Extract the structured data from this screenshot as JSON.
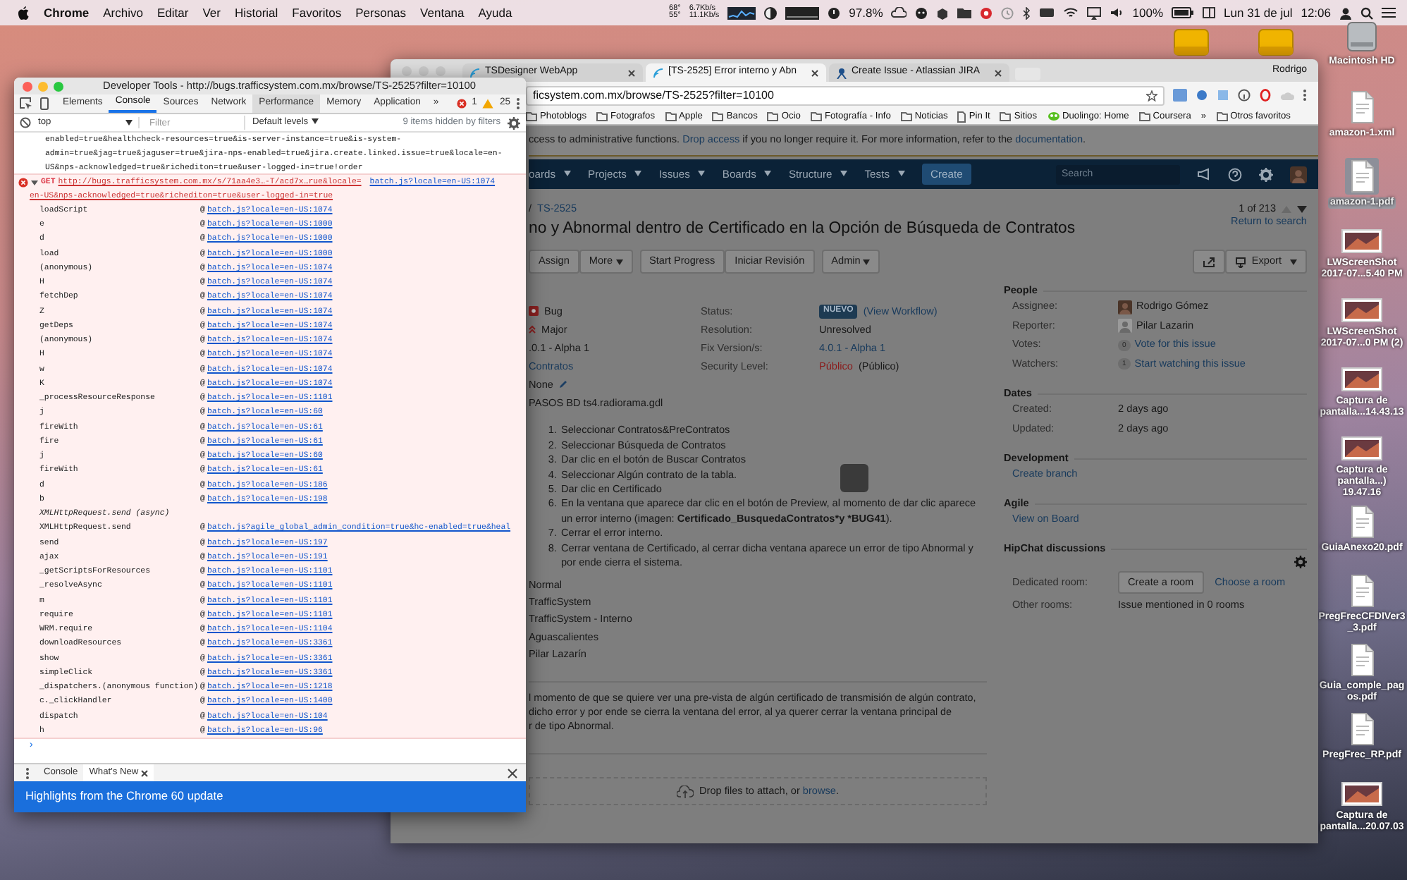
{
  "menu_bar": {
    "app": "Chrome",
    "menus": [
      "Archivo",
      "Editar",
      "Ver",
      "Historial",
      "Favoritos",
      "Personas",
      "Ventana",
      "Ayuda"
    ],
    "temperatures": [
      "68°",
      "55°"
    ],
    "network_speeds": [
      "6.7Kb/s",
      "11.1Kb/s"
    ],
    "cpu_reading": "97.8%",
    "battery_reading": "100%",
    "date": "Lun 31 de jul",
    "time": "12:06"
  },
  "desktop_drives": [
    {
      "kind": "external-drive"
    },
    {
      "kind": "external-drive"
    }
  ],
  "desktop_icons": [
    {
      "label": "Macintosh HD",
      "kind": "drive",
      "selected": false
    },
    {
      "label": "amazon-1.xml",
      "kind": "document",
      "selected": false
    },
    {
      "label": "amazon-1.pdf",
      "kind": "pdf",
      "selected": true
    },
    {
      "label": "LWScreenShot 2017-07...5.40 PM",
      "kind": "screenshot",
      "selected": false
    },
    {
      "label": "LWScreenShot 2017-07...0 PM (2)",
      "kind": "screenshot",
      "selected": false
    },
    {
      "label": "Captura de pantalla...14.43.13",
      "kind": "screenshot",
      "selected": false
    },
    {
      "label": "Captura de pantalla...) 19.47.16",
      "kind": "screenshot",
      "selected": false
    },
    {
      "label": "GuiaAnexo20.pdf",
      "kind": "pdf",
      "selected": false
    },
    {
      "label": "PregFrecCFDIVer3_3.pdf",
      "kind": "pdf",
      "selected": false
    },
    {
      "label": "Guia_comple_pagos.pdf",
      "kind": "pdf",
      "selected": false
    },
    {
      "label": "PregFrec_RP.pdf",
      "kind": "pdf",
      "selected": false
    },
    {
      "label": "Captura de pantalla...20.07.03",
      "kind": "screenshot",
      "selected": false
    }
  ],
  "browser": {
    "tabs": [
      {
        "title": "TSDesigner WebApp",
        "selected": false
      },
      {
        "title": "[TS-2525] Error interno y Abn",
        "selected": true
      },
      {
        "title": "Create Issue - Atlassian JIRA",
        "selected": false
      }
    ],
    "profile": "Rodrigo",
    "url": "ficsystem.com.mx/browse/TS-2525?filter=10100",
    "bookmarks": [
      {
        "label": "Photoblogs",
        "kind": "folder"
      },
      {
        "label": "Fotografos",
        "kind": "folder"
      },
      {
        "label": "Apple",
        "kind": "folder"
      },
      {
        "label": "Bancos",
        "kind": "folder"
      },
      {
        "label": "Ocio",
        "kind": "folder"
      },
      {
        "label": "Fotografía - Info",
        "kind": "folder"
      },
      {
        "label": "Noticias",
        "kind": "folder"
      },
      {
        "label": "Pin It",
        "kind": "page"
      },
      {
        "label": "Sitios",
        "kind": "folder"
      },
      {
        "label": "Duolingo: Home",
        "kind": "site"
      },
      {
        "label": "Coursera",
        "kind": "folder"
      }
    ],
    "bookmarks_overflow": "»",
    "other_bookmarks": "Otros favoritos"
  },
  "jira": {
    "banner": [
      {
        "text": "ccess to administrative functions. ",
        "kind": "text"
      },
      {
        "text": "Drop access",
        "kind": "link"
      },
      {
        "text": " if you no longer require it. For more information, refer to the ",
        "kind": "text"
      },
      {
        "text": "documentation",
        "kind": "link"
      },
      {
        "text": ".",
        "kind": "text"
      }
    ],
    "nav": [
      "oards",
      "Projects",
      "Issues",
      "Boards",
      "Structure",
      "Tests"
    ],
    "create": "Create",
    "search": {
      "placeholder": "Search"
    },
    "breadcrumb": "TS-2525",
    "breadcrumb_separator": "/",
    "title": "no y Abnormal dentro de Certificado en la Opción de Búsqueda de Contratos",
    "pager": "1 of 213",
    "return_link": "Return to search",
    "action_groups": [
      [
        {
          "label": "Assign",
          "dropdown": false
        },
        {
          "label": "More",
          "dropdown": true
        }
      ],
      [
        {
          "label": "Start Progress",
          "dropdown": false
        },
        {
          "label": "Iniciar Revisión",
          "dropdown": false
        }
      ],
      [
        {
          "label": "Admin",
          "dropdown": true
        }
      ]
    ],
    "export": "Export",
    "left_values": [
      {
        "text": "Bug",
        "kind": "issue-type"
      },
      {
        "text": "Major",
        "kind": "priority"
      },
      {
        "text": ".0.1 - Alpha 1",
        "kind": "text"
      },
      {
        "text": "Contratos",
        "kind": "link"
      },
      {
        "text": "None",
        "kind": "editable"
      }
    ],
    "fields": [
      {
        "label": "Status:",
        "value": "NUEVO",
        "note": "(View Workflow)",
        "kind": "status"
      },
      {
        "label": "Resolution:",
        "value": "Unresolved",
        "kind": "text"
      },
      {
        "label": "Fix Version/s:",
        "value": "4.0.1 - Alpha 1",
        "kind": "link"
      },
      {
        "label": "Security Level:",
        "value": "Público",
        "note": "(Público)",
        "kind": "security"
      }
    ],
    "description_heading": "PASOS BD ts4.radiorama.gdl",
    "steps": [
      {
        "number": "1.",
        "parts": [
          {
            "text": "Seleccionar Contratos&PreContratos",
            "bold": false
          }
        ]
      },
      {
        "number": "2.",
        "parts": [
          {
            "text": "Seleccionar Búsqueda de Contratos",
            "bold": false
          }
        ]
      },
      {
        "number": "3.",
        "parts": [
          {
            "text": "Dar clic en el botón de Buscar Contratos",
            "bold": false
          }
        ]
      },
      {
        "number": "4.",
        "parts": [
          {
            "text": "Seleccionar Algún contrato de la tabla.",
            "bold": false
          }
        ]
      },
      {
        "number": "5.",
        "parts": [
          {
            "text": "Dar clic en Certificado",
            "bold": false
          }
        ]
      },
      {
        "number": "6.",
        "parts": [
          {
            "text": "En la ventana que aparece dar clic en el botón de Preview, al momento de dar clic aparece un error interno (imagen: ",
            "bold": false
          },
          {
            "text": "Certificado_BusquedaContratos*y *BUG41",
            "bold": true
          },
          {
            "text": ").",
            "bold": false
          }
        ]
      },
      {
        "number": "7.",
        "parts": [
          {
            "text": "Cerrar el error interno.",
            "bold": false
          }
        ]
      },
      {
        "number": "8.",
        "parts": [
          {
            "text": "Cerrar ventana de Certificado, al cerrar dicha ventana aparece un error de tipo Abnormal y por ende cierra el sistema.",
            "bold": false
          }
        ]
      }
    ],
    "more_values": [
      "Normal",
      "TrafficSystem",
      "TrafficSystem - Interno",
      "Aguascalientes",
      "Pilar Lazarín"
    ],
    "comment_lines": [
      "l momento de que se quiere ver una pre-vista de algún certificado de transmisión de algún contrato,",
      "dicho error y por ende se cierra la ventana del error, al ya querer cerrar la ventana principal de",
      "r de tipo Abnormal."
    ],
    "drop_zone": {
      "text": "Drop files to attach, or ",
      "link": "browse",
      "end": "."
    },
    "people": {
      "heading": "People",
      "rows": [
        {
          "label": "Assignee:",
          "value": "Rodrigo Gómez",
          "kind": "avatar"
        },
        {
          "label": "Reporter:",
          "value": "Pilar Lazarin",
          "kind": "silhouette"
        },
        {
          "label": "Votes:",
          "count": "0",
          "value": "Vote for this issue",
          "kind": "count"
        },
        {
          "label": "Watchers:",
          "count": "1",
          "value": "Start watching this issue",
          "kind": "count"
        }
      ]
    },
    "dates": {
      "heading": "Dates",
      "rows": [
        {
          "label": "Created:",
          "value": "2 days ago"
        },
        {
          "label": "Updated:",
          "value": "2 days ago"
        }
      ]
    },
    "development": {
      "heading": "Development",
      "link": "Create branch"
    },
    "agile": {
      "heading": "Agile",
      "link": "View on Board"
    },
    "hipchat": {
      "heading": "HipChat discussions",
      "dedicated_label": "Dedicated room:",
      "create_button": "Create a room",
      "choose_link": "Choose a room",
      "other_label": "Other rooms:",
      "other_value": "Issue mentioned in 0 rooms"
    }
  },
  "devtools": {
    "title": "Developer Tools - http://bugs.trafficsystem.com.mx/browse/TS-2525?filter=10100",
    "tabs": [
      {
        "label": "Elements",
        "selected": false,
        "highlighted": false
      },
      {
        "label": "Console",
        "selected": true,
        "highlighted": false
      },
      {
        "label": "Sources",
        "selected": false,
        "highlighted": false
      },
      {
        "label": "Network",
        "selected": false,
        "highlighted": false
      },
      {
        "label": "Performance",
        "selected": false,
        "highlighted": true
      },
      {
        "label": "Memory",
        "selected": false,
        "highlighted": false
      },
      {
        "label": "Application",
        "selected": false,
        "highlighted": false
      }
    ],
    "tabs_overflow": "»",
    "error_count": "1",
    "warning_count": "25",
    "context": "top",
    "filter": {
      "placeholder": "Filter"
    },
    "levels": "Default levels",
    "hidden_note": "9 items hidden by filters",
    "log_lines": [
      "enabled=true&healthcheck-resources=true&is-server-instance=true&is-system-",
      "admin=true&jag=true&jaguser=true&jira-nps-enabled=true&jira.create.linked.issue=true&locale=en-",
      "US&nps-acknowledged=true&richediton=true&user-logged-in=true!order"
    ],
    "error": {
      "method": "GET",
      "url": "http://bugs.trafficsystem.com.mx/s/71aa4e3…-T/acd7x…rue&locale=",
      "source": "batch.js?locale=en-US:1074",
      "url_continued": "en-US&nps-acknowledged=true&richediton=true&user-logged-in=true"
    },
    "frames": [
      {
        "function": "loadScript",
        "at": "@",
        "location": "batch.js?locale=en-US:1074",
        "kind": "frame"
      },
      {
        "function": "e",
        "at": "@",
        "location": "batch.js?locale=en-US:1000",
        "kind": "frame"
      },
      {
        "function": "d",
        "at": "@",
        "location": "batch.js?locale=en-US:1000",
        "kind": "frame"
      },
      {
        "function": "load",
        "at": "@",
        "location": "batch.js?locale=en-US:1000",
        "kind": "frame"
      },
      {
        "function": "(anonymous)",
        "at": "@",
        "location": "batch.js?locale=en-US:1074",
        "kind": "frame"
      },
      {
        "function": "H",
        "at": "@",
        "location": "batch.js?locale=en-US:1074",
        "kind": "frame"
      },
      {
        "function": "fetchDep",
        "at": "@",
        "location": "batch.js?locale=en-US:1074",
        "kind": "frame"
      },
      {
        "function": "Z",
        "at": "@",
        "location": "batch.js?locale=en-US:1074",
        "kind": "frame"
      },
      {
        "function": "getDeps",
        "at": "@",
        "location": "batch.js?locale=en-US:1074",
        "kind": "frame"
      },
      {
        "function": "(anonymous)",
        "at": "@",
        "location": "batch.js?locale=en-US:1074",
        "kind": "frame"
      },
      {
        "function": "H",
        "at": "@",
        "location": "batch.js?locale=en-US:1074",
        "kind": "frame"
      },
      {
        "function": "w",
        "at": "@",
        "location": "batch.js?locale=en-US:1074",
        "kind": "frame"
      },
      {
        "function": "K",
        "at": "@",
        "location": "batch.js?locale=en-US:1074",
        "kind": "frame"
      },
      {
        "function": "_processResourceResponse",
        "at": "@",
        "location": "batch.js?locale=en-US:1101",
        "kind": "frame"
      },
      {
        "function": "j",
        "at": "@",
        "location": "batch.js?locale=en-US:60",
        "kind": "frame"
      },
      {
        "function": "fireWith",
        "at": "@",
        "location": "batch.js?locale=en-US:61",
        "kind": "frame"
      },
      {
        "function": "fire",
        "at": "@",
        "location": "batch.js?locale=en-US:61",
        "kind": "frame"
      },
      {
        "function": "j",
        "at": "@",
        "location": "batch.js?locale=en-US:60",
        "kind": "frame"
      },
      {
        "function": "fireWith",
        "at": "@",
        "location": "batch.js?locale=en-US:61",
        "kind": "frame"
      },
      {
        "function": "d",
        "at": "@",
        "location": "batch.js?locale=en-US:186",
        "kind": "frame"
      },
      {
        "function": "b",
        "at": "@",
        "location": "batch.js?locale=en-US:198",
        "kind": "frame"
      },
      {
        "function": "XMLHttpRequest.send (async)",
        "kind": "async"
      },
      {
        "function": "XMLHttpRequest.send",
        "at": "@",
        "location": "batch.js?agile_global_admin_condition=true&hc-enabled=true&heal",
        "kind": "frame"
      },
      {
        "function": "send",
        "at": "@",
        "location": "batch.js?locale=en-US:197",
        "kind": "frame"
      },
      {
        "function": "ajax",
        "at": "@",
        "location": "batch.js?locale=en-US:191",
        "kind": "frame"
      },
      {
        "function": "_getScriptsForResources",
        "at": "@",
        "location": "batch.js?locale=en-US:1101",
        "kind": "frame"
      },
      {
        "function": "_resolveAsync",
        "at": "@",
        "location": "batch.js?locale=en-US:1101",
        "kind": "frame"
      },
      {
        "function": "m",
        "at": "@",
        "location": "batch.js?locale=en-US:1101",
        "kind": "frame"
      },
      {
        "function": "require",
        "at": "@",
        "location": "batch.js?locale=en-US:1101",
        "kind": "frame"
      },
      {
        "function": "WRM.require",
        "at": "@",
        "location": "batch.js?locale=en-US:1104",
        "kind": "frame"
      },
      {
        "function": "downloadResources",
        "at": "@",
        "location": "batch.js?locale=en-US:3361",
        "kind": "frame"
      },
      {
        "function": "show",
        "at": "@",
        "location": "batch.js?locale=en-US:3361",
        "kind": "frame"
      },
      {
        "function": "simpleClick",
        "at": "@",
        "location": "batch.js?locale=en-US:3361",
        "kind": "frame"
      },
      {
        "function": "_dispatchers.(anonymous function)",
        "at": "@",
        "location": "batch.js?locale=en-US:1218",
        "kind": "frame"
      },
      {
        "function": "c._clickHandler",
        "at": "@",
        "location": "batch.js?locale=en-US:1400",
        "kind": "frame"
      },
      {
        "function": "dispatch",
        "at": "@",
        "location": "batch.js?locale=en-US:104",
        "kind": "frame"
      },
      {
        "function": "h",
        "at": "@",
        "location": "batch.js?locale=en-US:96",
        "kind": "frame"
      }
    ],
    "prompt": "›",
    "drawer_tabs": [
      {
        "label": "Console",
        "selected": false
      },
      {
        "label": "What's New",
        "selected": true
      }
    ],
    "banner": "Highlights from the Chrome 60 update"
  }
}
